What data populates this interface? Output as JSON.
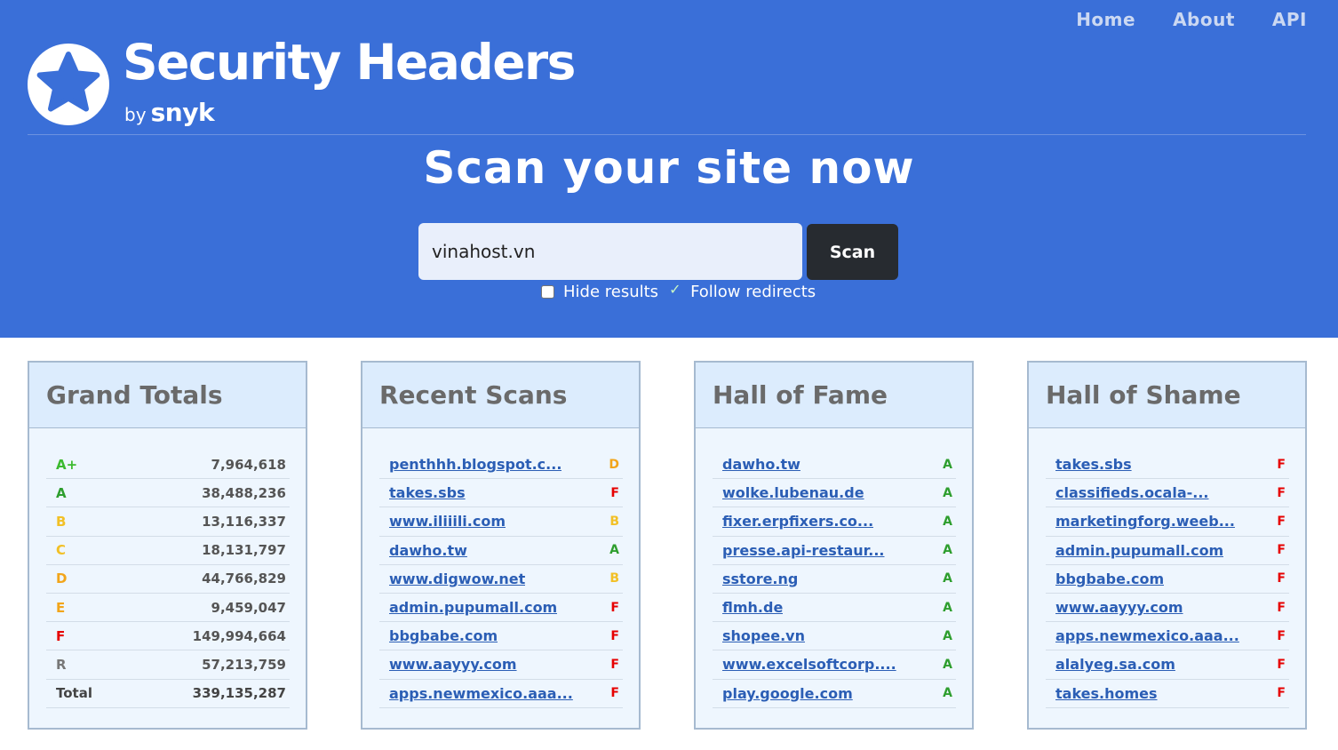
{
  "site": {
    "title": "Security Headers",
    "by_prefix": "by",
    "by_brand": "snyk",
    "logo_icon": "star-icon"
  },
  "nav": [
    {
      "label": "Home"
    },
    {
      "label": "About"
    },
    {
      "label": "API"
    }
  ],
  "hero": {
    "heading": "Scan your site now",
    "input_value": "vinahost.vn",
    "scan_label": "Scan",
    "hide_results_label": "Hide results",
    "hide_results_checked": false,
    "follow_redirects_label": "Follow redirects",
    "follow_redirects_checked": true
  },
  "colors": {
    "hero_bg": "#3a6fd8",
    "grade_aplus": "#3cba2f",
    "grade_a": "#2e9e2e",
    "grade_b": "#f2c026",
    "grade_c": "#f2c026",
    "grade_d": "#f2a51a",
    "grade_e": "#f2a51a",
    "grade_f": "#e60000",
    "grade_r": "#777777"
  },
  "grand_totals": {
    "title": "Grand Totals",
    "rows": [
      {
        "grade": "A+",
        "count": "7,964,618"
      },
      {
        "grade": "A",
        "count": "38,488,236"
      },
      {
        "grade": "B",
        "count": "13,116,337"
      },
      {
        "grade": "C",
        "count": "18,131,797"
      },
      {
        "grade": "D",
        "count": "44,766,829"
      },
      {
        "grade": "E",
        "count": "9,459,047"
      },
      {
        "grade": "F",
        "count": "149,994,664"
      },
      {
        "grade": "R",
        "count": "57,213,759"
      },
      {
        "grade": "Total",
        "count": "339,135,287"
      }
    ]
  },
  "recent_scans": {
    "title": "Recent Scans",
    "rows": [
      {
        "site": "penthhh.blogspot.c...",
        "grade": "D"
      },
      {
        "site": "takes.sbs",
        "grade": "F"
      },
      {
        "site": "www.iliiili.com",
        "grade": "B"
      },
      {
        "site": "dawho.tw",
        "grade": "A"
      },
      {
        "site": "www.digwow.net",
        "grade": "B"
      },
      {
        "site": "admin.pupumall.com",
        "grade": "F"
      },
      {
        "site": "bbgbabe.com",
        "grade": "F"
      },
      {
        "site": "www.aayyy.com",
        "grade": "F"
      },
      {
        "site": "apps.newmexico.aaa...",
        "grade": "F"
      }
    ]
  },
  "hall_of_fame": {
    "title": "Hall of Fame",
    "rows": [
      {
        "site": "dawho.tw",
        "grade": "A"
      },
      {
        "site": "wolke.lubenau.de",
        "grade": "A"
      },
      {
        "site": "fixer.erpfixers.co...",
        "grade": "A"
      },
      {
        "site": "presse.api-restaur...",
        "grade": "A"
      },
      {
        "site": "sstore.ng",
        "grade": "A"
      },
      {
        "site": "flmh.de",
        "grade": "A"
      },
      {
        "site": "shopee.vn",
        "grade": "A"
      },
      {
        "site": "www.excelsoftcorp....",
        "grade": "A"
      },
      {
        "site": "play.google.com",
        "grade": "A"
      }
    ]
  },
  "hall_of_shame": {
    "title": "Hall of Shame",
    "rows": [
      {
        "site": "takes.sbs",
        "grade": "F"
      },
      {
        "site": "classifieds.ocala-...",
        "grade": "F"
      },
      {
        "site": "marketingforg.weeb...",
        "grade": "F"
      },
      {
        "site": "admin.pupumall.com",
        "grade": "F"
      },
      {
        "site": "bbgbabe.com",
        "grade": "F"
      },
      {
        "site": "www.aayyy.com",
        "grade": "F"
      },
      {
        "site": "apps.newmexico.aaa...",
        "grade": "F"
      },
      {
        "site": "alalyeg.sa.com",
        "grade": "F"
      },
      {
        "site": "takes.homes",
        "grade": "F"
      }
    ]
  }
}
